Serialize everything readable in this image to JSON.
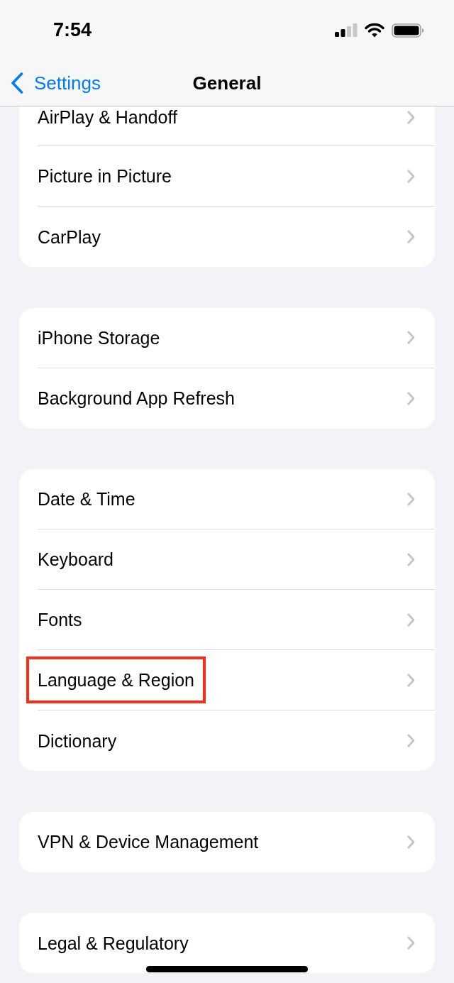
{
  "status_bar": {
    "time": "7:54"
  },
  "nav_bar": {
    "back_label": "Settings",
    "title": "General"
  },
  "groups": [
    {
      "items": [
        {
          "label": "AirPlay & Handoff",
          "highlighted": false
        },
        {
          "label": "Picture in Picture",
          "highlighted": false
        },
        {
          "label": "CarPlay",
          "highlighted": false
        }
      ]
    },
    {
      "items": [
        {
          "label": "iPhone Storage",
          "highlighted": false
        },
        {
          "label": "Background App Refresh",
          "highlighted": false
        }
      ]
    },
    {
      "items": [
        {
          "label": "Date & Time",
          "highlighted": false
        },
        {
          "label": "Keyboard",
          "highlighted": false
        },
        {
          "label": "Fonts",
          "highlighted": false
        },
        {
          "label": "Language & Region",
          "highlighted": true
        },
        {
          "label": "Dictionary",
          "highlighted": false
        }
      ]
    },
    {
      "items": [
        {
          "label": "VPN & Device Management",
          "highlighted": false
        }
      ]
    },
    {
      "items": [
        {
          "label": "Legal & Regulatory",
          "highlighted": false
        }
      ]
    }
  ]
}
